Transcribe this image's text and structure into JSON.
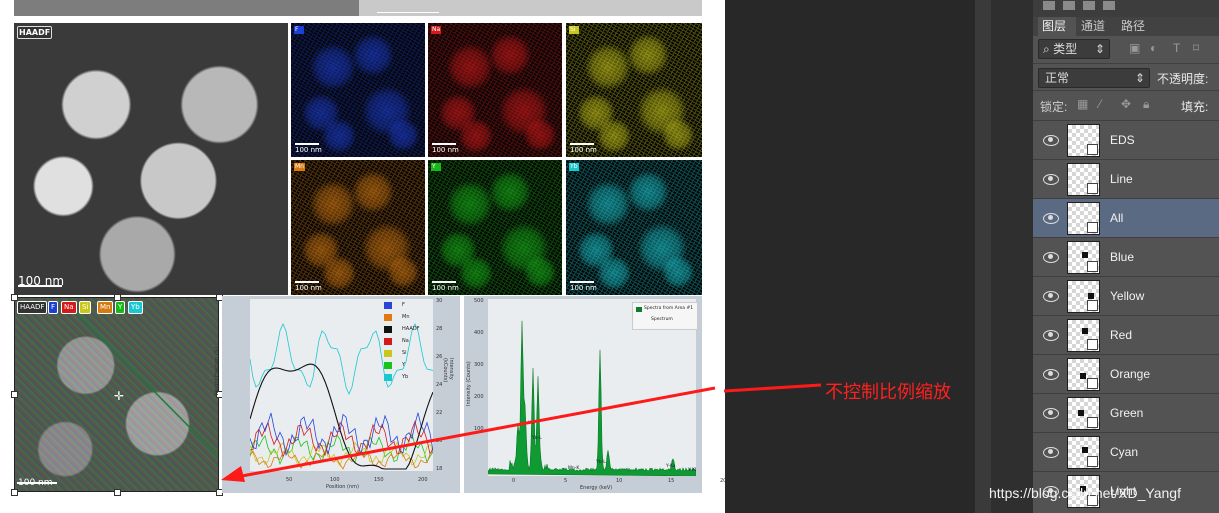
{
  "canvas": {
    "haadf_tag": "HAADF",
    "haadf_scale": "100 nm",
    "tile_scale": "100 nm",
    "tiles": [
      {
        "tag": "F",
        "color": "#1d3fd6"
      },
      {
        "tag": "Na",
        "color": "#d41a1a"
      },
      {
        "tag": "Si",
        "color": "#c9c81a"
      },
      {
        "tag": "Mn",
        "color": "#d67a12"
      },
      {
        "tag": "Y",
        "color": "#18b818"
      },
      {
        "tag": "Yb",
        "color": "#1bc8d0"
      }
    ],
    "overlay_badges": [
      "HAADF",
      "F",
      "Na",
      "Si",
      "Mn",
      "Y",
      "Yb"
    ],
    "overlay_scale": "100 nm",
    "annotation": "不控制比例缩放",
    "linescan": {
      "legend": [
        "F",
        "Mn",
        "HAADF",
        "Na",
        "Si",
        "Y",
        "Yb"
      ],
      "ylabel_left": "Weight Fraction (%)",
      "ylabel_right": "Intensity (kCounts)",
      "xlabel": "Position (nm)",
      "xticks": [
        "50",
        "100",
        "150",
        "200"
      ],
      "yticks_right": [
        "30",
        "28",
        "26",
        "24",
        "22",
        "20",
        "18"
      ]
    },
    "spectrum": {
      "legend_title": "Spectra from Area #1",
      "legend_item": "Spectrum",
      "ylabel": "Intensity (Counts)",
      "xlabel": "Energy (keV)",
      "xticks": [
        "0",
        "5",
        "10",
        "15",
        "20"
      ],
      "yticks": [
        "500",
        "400",
        "300",
        "200",
        "100"
      ],
      "peaks": [
        "Y-L",
        "Yb-L",
        "Mn-K",
        "Yb-L",
        "Y-Ka",
        "Y-Kb"
      ]
    }
  },
  "layers_panel": {
    "tabs": [
      "图层",
      "通道",
      "路径"
    ],
    "filter_label": "类型",
    "blend_mode": "正常",
    "opacity_label": "不透明度:",
    "lock_label": "锁定:",
    "fill_label": "填充:",
    "layers": [
      "EDS",
      "Line",
      "All",
      "Blue",
      "Yellow",
      "Red",
      "Orange",
      "Green",
      "Cyan",
      "Light"
    ],
    "selected_layer": "All"
  },
  "watermark": "https://blog.csdn.net/XD_Yangf"
}
